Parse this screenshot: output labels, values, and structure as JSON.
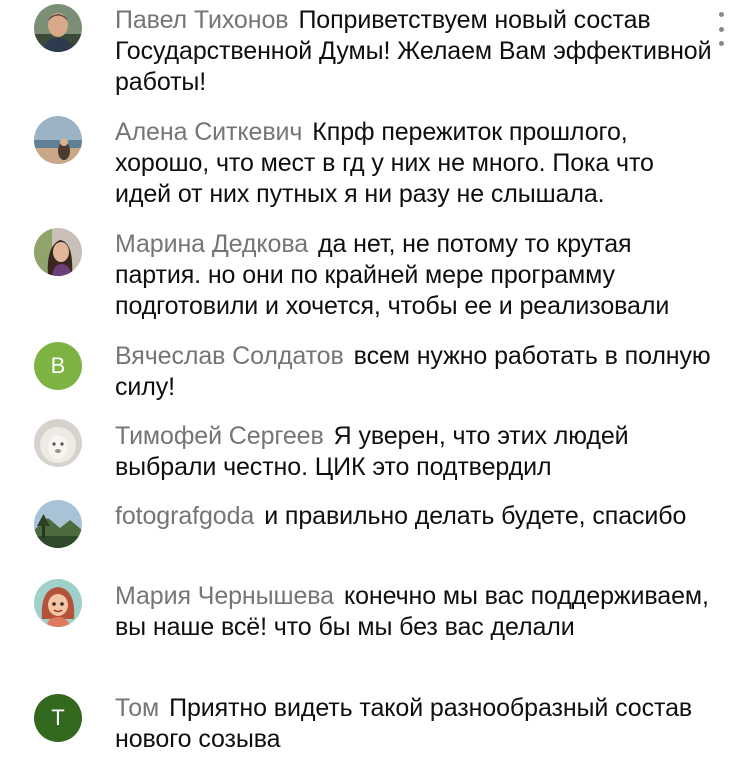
{
  "comments": [
    {
      "author": "Павел Тихонов",
      "text": "Поприветствуем новый состав Государственной Думы! Желаем Вам эффективной работы!",
      "avatar": "photo-man-icon"
    },
    {
      "author": "Алена Ситкевич",
      "text": "Кпрф пережиток прошлого, хорошо, что мест в гд у них не много. Пока что идей от них путных я ни разу не слышала.",
      "avatar": "photo-beach-icon"
    },
    {
      "author": "Марина Дедкова",
      "text": "да нет, не потому то крутая партия. но они по крайней мере программу подготовили и хочется, чтобы ее и реализовали",
      "avatar": "photo-woman-icon"
    },
    {
      "author": "Вячеслав Солдатов",
      "text": "всем нужно работать в полную силу!",
      "avatar_letter": "В",
      "avatar_color": "#7cb342"
    },
    {
      "author": "Тимофей Сергеев",
      "text": "Я уверен, что этих людей выбрали честно. ЦИК это подтвердил",
      "avatar": "photo-lion-icon"
    },
    {
      "author": "fotografgoda",
      "text": "и правильно делать будете, спасибо",
      "avatar": "photo-landscape-icon"
    },
    {
      "author": "Мария Чернышева",
      "text": "конечно мы вас поддерживаем, вы наше всё! что бы мы без вас делали",
      "avatar": "cartoon-girl-icon"
    },
    {
      "author": "Том",
      "text": "Приятно видеть такой разнообразный состав нового созыва",
      "avatar_letter": "Т",
      "avatar_color": "#33691e"
    }
  ],
  "menu_icon": "more-vertical-icon"
}
